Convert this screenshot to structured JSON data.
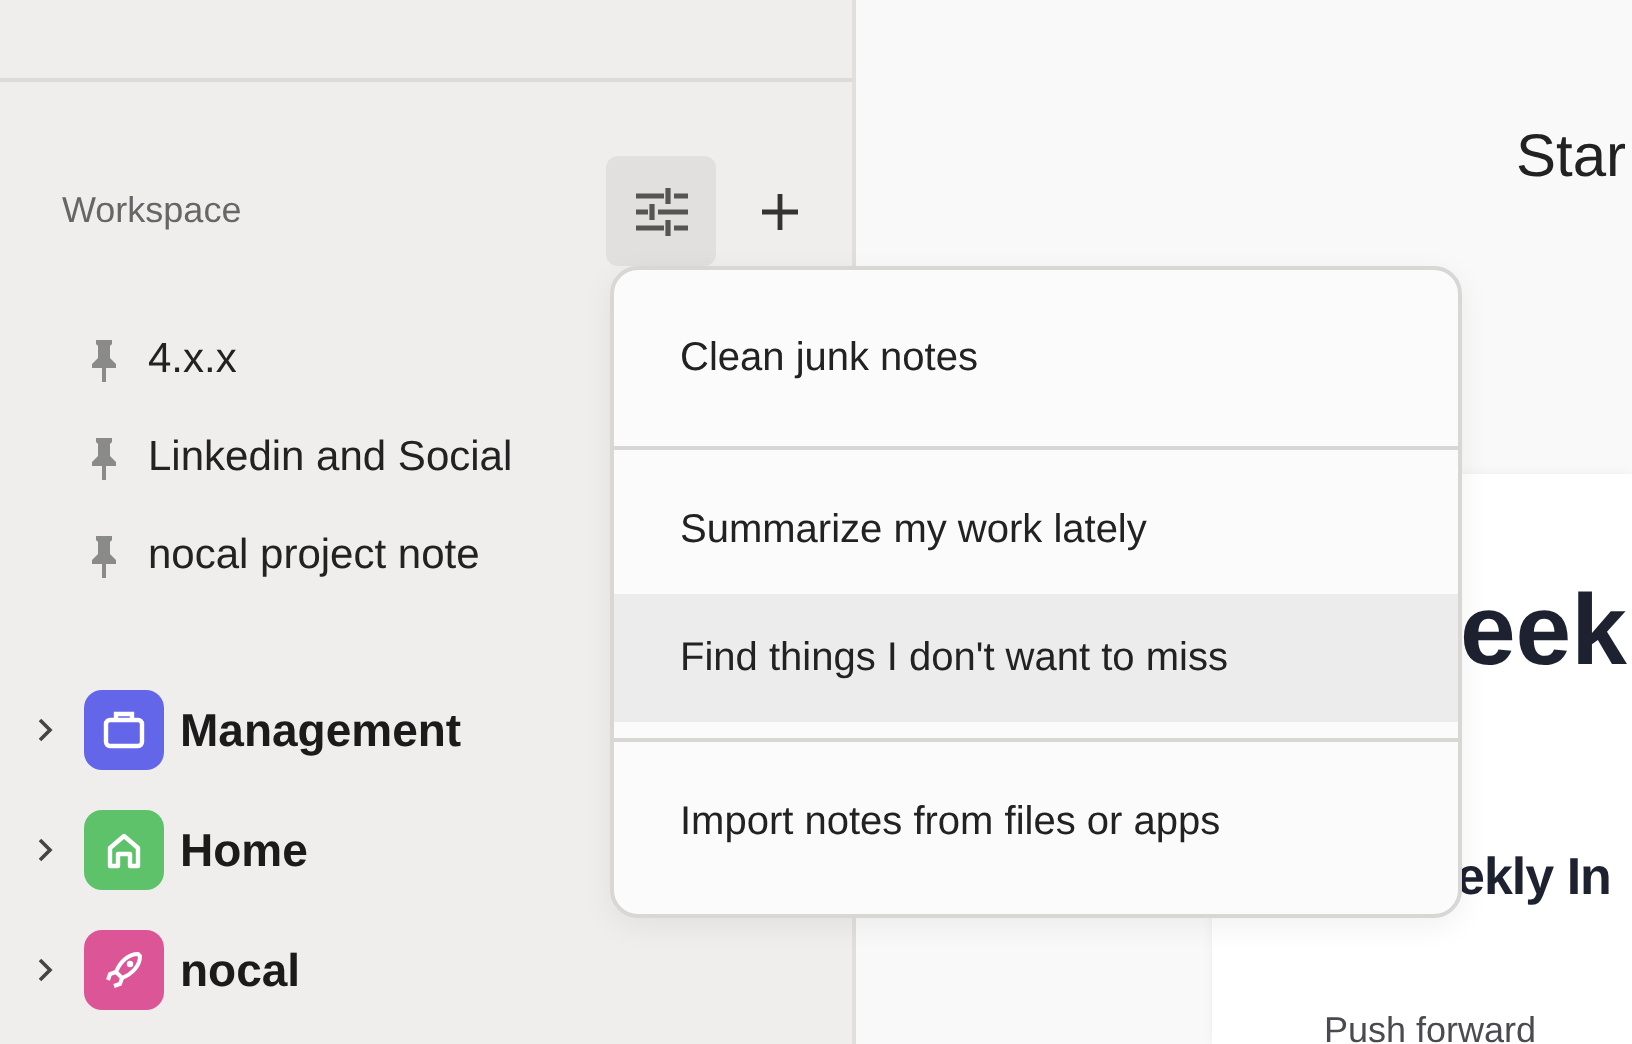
{
  "sidebar": {
    "workspace_label": "Workspace",
    "pinned_notes": [
      {
        "label": "4.x.x"
      },
      {
        "label": "Linkedin and Social"
      },
      {
        "label": "nocal project note"
      }
    ],
    "spaces": [
      {
        "label": "Management",
        "kind": "briefcase",
        "color": "#6466e9",
        "expanded": false
      },
      {
        "label": "Home",
        "kind": "home",
        "color": "#5dc26a",
        "expanded": false
      },
      {
        "label": "nocal",
        "kind": "rocket",
        "color": "#dc5597",
        "expanded": false
      }
    ]
  },
  "menu": {
    "sections": [
      [
        {
          "label": "Clean junk notes",
          "selected": false
        }
      ],
      [
        {
          "label": "Summarize my work lately",
          "selected": false
        },
        {
          "label": "Find things I don't want to miss",
          "selected": true
        }
      ],
      [
        {
          "label": "Import notes from files or apps",
          "selected": false
        }
      ]
    ]
  },
  "main": {
    "header_text": "Star",
    "card": {
      "title": "eek",
      "heading": "ekly In",
      "paragraph": "Push forward"
    }
  }
}
